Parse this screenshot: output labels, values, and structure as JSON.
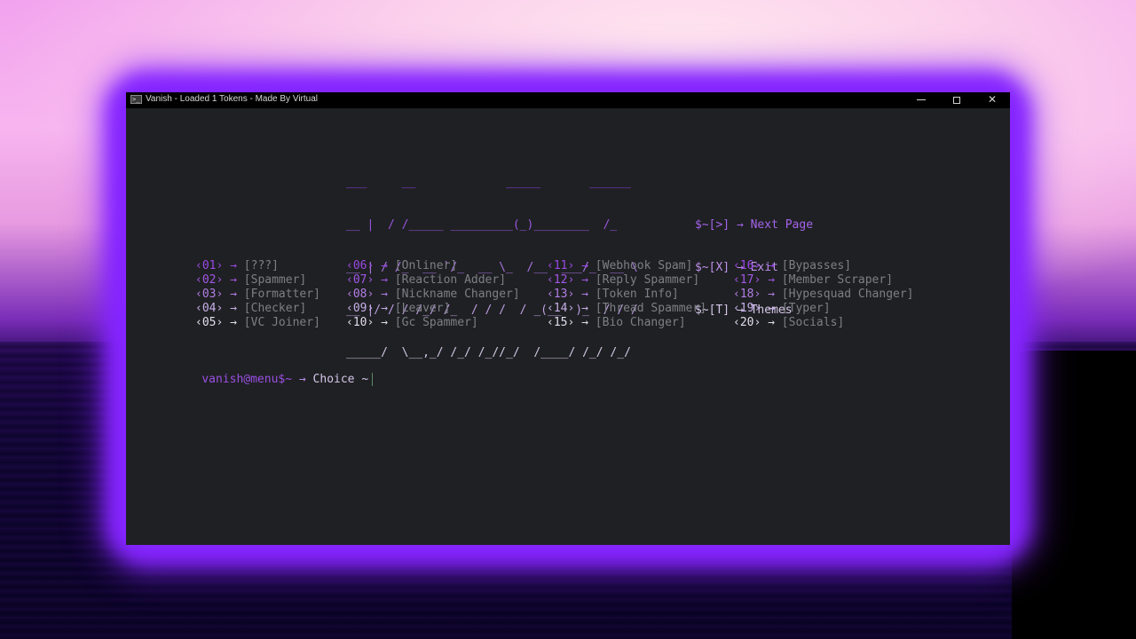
{
  "window": {
    "title": "Vanish - Loaded 1 Tokens - Made By Virtual",
    "icon": "terminal-icon",
    "controls": {
      "minimize": "minimize-icon",
      "maximize": "maximize-icon",
      "close": "close-icon"
    }
  },
  "colors": {
    "accent": "#8524ff",
    "purple_text": "#9b4be6",
    "light_text": "#d9d4e8",
    "label_gray": "#7d7f86",
    "terminal_bg": "#1f2023",
    "titlebar_bg": "#000000"
  },
  "banner": {
    "ascii_lines": [
      "___     __             _____       ______ ",
      "__ |  / /_____ _________(_)________  /_ ",
      "__ | / /_  __ `/_  __ \\_  /__  ___/_  __ \\",
      "__ |/ / / /_/ /_  / / /  / _(__  )_  / / /",
      "_____/  \\__,_/ /_/ /_//_/  /____/ /_/ /_/ "
    ],
    "options": [
      {
        "key": "$~[>]",
        "arrow": "→",
        "label": "Next Page"
      },
      {
        "key": "$~[X]",
        "arrow": "→",
        "label": "Exit"
      },
      {
        "key": "$~[T]",
        "arrow": "→",
        "label": "Themes"
      }
    ]
  },
  "menu": {
    "columns": [
      [
        {
          "num": "‹01›",
          "arrow": "→",
          "label": "[???]"
        },
        {
          "num": "‹02›",
          "arrow": "→",
          "label": "[Spammer]"
        },
        {
          "num": "‹03›",
          "arrow": "→",
          "label": "[Formatter]"
        },
        {
          "num": "‹04›",
          "arrow": "→",
          "label": "[Checker]"
        },
        {
          "num": "‹05›",
          "arrow": "→",
          "label": "[VC Joiner]"
        }
      ],
      [
        {
          "num": "‹06›",
          "arrow": "→",
          "label": "[Onliner]"
        },
        {
          "num": "‹07›",
          "arrow": "→",
          "label": "[Reaction Adder]"
        },
        {
          "num": "‹08›",
          "arrow": "→",
          "label": "[Nickname Changer]"
        },
        {
          "num": "‹09›",
          "arrow": "→",
          "label": "[Leaver]"
        },
        {
          "num": "‹10›",
          "arrow": "→",
          "label": "[Gc Spammer]"
        }
      ],
      [
        {
          "num": "‹11›",
          "arrow": "→",
          "label": "[Webhook Spam]"
        },
        {
          "num": "‹12›",
          "arrow": "→",
          "label": "[Reply Spammer]"
        },
        {
          "num": "‹13›",
          "arrow": "→",
          "label": "[Token Info]"
        },
        {
          "num": "‹14›",
          "arrow": "→",
          "label": "[Thread Spammer]"
        },
        {
          "num": "‹15›",
          "arrow": "→",
          "label": "[Bio Changer]"
        }
      ],
      [
        {
          "num": "‹16›",
          "arrow": "→",
          "label": "[Bypasses]"
        },
        {
          "num": "‹17›",
          "arrow": "→",
          "label": "[Member Scraper]"
        },
        {
          "num": "‹18›",
          "arrow": "→",
          "label": "[Hypesquad Changer]"
        },
        {
          "num": "‹19›",
          "arrow": "→",
          "label": "[Typer]"
        },
        {
          "num": "‹20›",
          "arrow": "→",
          "label": "[Socials]"
        }
      ]
    ]
  },
  "prompt": {
    "user_host": "vanish@menu$~",
    "arrow": "→",
    "text": "Choice ~",
    "input_value": ""
  }
}
